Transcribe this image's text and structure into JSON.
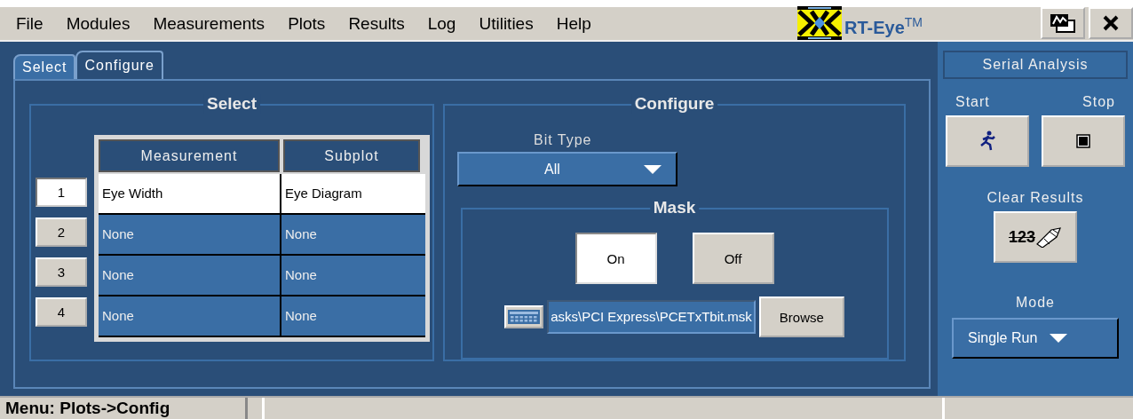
{
  "menu": [
    "File",
    "Modules",
    "Measurements",
    "Plots",
    "Results",
    "Log",
    "Utilities",
    "Help"
  ],
  "app_title": {
    "name": "RT-Eye",
    "mark": "TM"
  },
  "tabs": [
    {
      "label": "Select",
      "selected": false
    },
    {
      "label": "Configure",
      "selected": true
    }
  ],
  "select_group": {
    "title": "Select",
    "columns": [
      "Measurement",
      "Subplot"
    ],
    "rows": [
      {
        "number": "1",
        "selected": true,
        "measurement": "Eye Width",
        "subplot": "Eye Diagram"
      },
      {
        "number": "2",
        "selected": false,
        "measurement": "None",
        "subplot": "None"
      },
      {
        "number": "3",
        "selected": false,
        "measurement": "None",
        "subplot": "None"
      },
      {
        "number": "4",
        "selected": false,
        "measurement": "None",
        "subplot": "None"
      }
    ]
  },
  "configure_group": {
    "title": "Configure",
    "bit_type_label": "Bit Type",
    "bit_type_value": "All",
    "mask": {
      "title": "Mask",
      "options": [
        {
          "label": "On",
          "selected": true
        },
        {
          "label": "Off",
          "selected": false
        }
      ],
      "file_path": "asks\\PCI Express\\PCETxTbit.msk",
      "browse": "Browse"
    }
  },
  "side_panel": {
    "title": "Serial Analysis",
    "start_label": "Start",
    "stop_label": "Stop",
    "clear_label": "Clear Results",
    "clear_icon_text": "123",
    "mode_label": "Mode",
    "mode_value": "Single Run"
  },
  "status_bar": {
    "text": "Menu: Plots->Config"
  }
}
